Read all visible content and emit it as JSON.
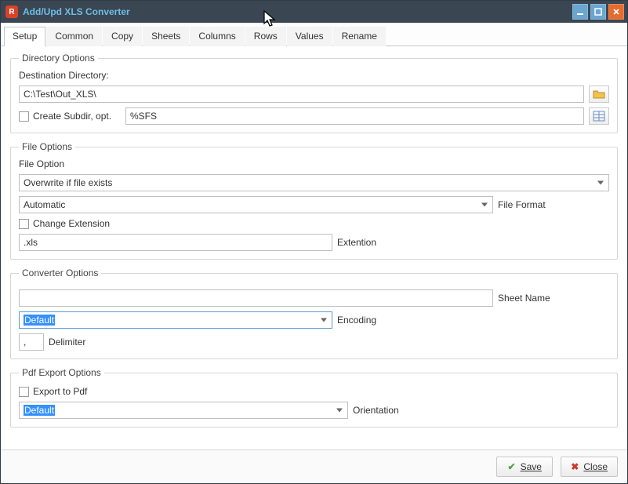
{
  "window": {
    "title": "Add/Upd XLS Converter"
  },
  "tabs": [
    "Setup",
    "Common",
    "Copy",
    "Sheets",
    "Columns",
    "Rows",
    "Values",
    "Rename"
  ],
  "active_tab": 0,
  "dir_options": {
    "legend": "Directory Options",
    "dest_label": "Destination Directory:",
    "dest_value": "C:\\Test\\Out_XLS\\",
    "create_subdir_label": "Create Subdir, opt.",
    "subdir_value": "%SFS"
  },
  "file_options": {
    "legend": "File Options",
    "file_option_label": "File Option",
    "file_option_value": "Overwrite if file exists",
    "file_format_value": "Automatic",
    "file_format_label": "File Format",
    "change_ext_label": "Change Extension",
    "ext_value": ".xls",
    "ext_label": "Extention"
  },
  "conv_options": {
    "legend": "Converter Options",
    "sheet_name_label": "Sheet Name",
    "sheet_name_value": "",
    "encoding_value": "Default",
    "encoding_label": "Encoding",
    "delimiter_value": ",",
    "delimiter_label": "Delimiter"
  },
  "pdf_options": {
    "legend": "Pdf Export Options",
    "export_label": "Export to Pdf",
    "orientation_value": "Default",
    "orientation_label": "Orientation"
  },
  "buttons": {
    "save": "Save",
    "close": "Close"
  }
}
